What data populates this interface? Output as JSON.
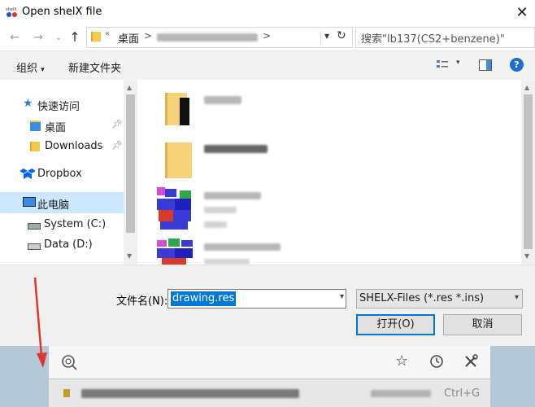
{
  "window": {
    "title": "Open shelX file",
    "close_glyph": "✕",
    "app_icon_text": "shelX"
  },
  "nav": {
    "back_glyph": "←",
    "forward_glyph": "→",
    "recent_glyph": "⌄",
    "up_glyph": "↑",
    "breadcrumb_root": "桌面",
    "breadcrumb_sep": ">",
    "breadcrumb_more": "«",
    "refresh_glyph": "↻",
    "search_placeholder": "搜索\"lb137(CS2+benzene)\""
  },
  "toolbar": {
    "organize": "组织",
    "organize_caret": "▾",
    "new_folder": "新建文件夹",
    "view_caret": "▾",
    "help": "?"
  },
  "sidebar": {
    "quick_access": "快速访问",
    "desktop": "桌面",
    "downloads": "Downloads",
    "dropbox": "Dropbox",
    "this_pc": "此电脑",
    "system_c": "System (C:)",
    "data_d": "Data (D:)"
  },
  "bottom": {
    "filename_label": "文件名(N):",
    "filename_value": "drawing.res",
    "filter_value": "SHELX-Files (*.res *.ins)",
    "open": "打开(O)",
    "cancel": "取消"
  },
  "lower_window": {
    "shortcut": "Ctrl+G"
  },
  "colors": {
    "accent": "#0078d7",
    "arrow": "#e0352b",
    "folder": "#f6d27a"
  }
}
